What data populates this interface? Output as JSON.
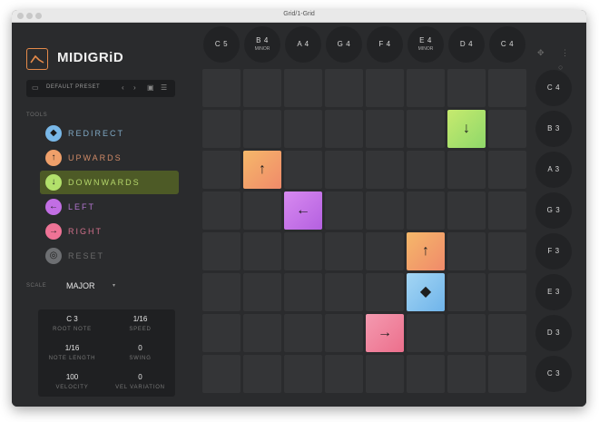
{
  "window_title": "Grid/1-Grid",
  "app_name": "MIDIGRiD",
  "preset": {
    "name": "DEFAULT PRESET",
    "prev": "‹",
    "next": "›"
  },
  "tools_heading": "TOOLS",
  "tools": [
    {
      "label": "REDIRECT",
      "icon": "◆",
      "color": "#79b8e8",
      "text_color": "#7fa8c4",
      "active": false
    },
    {
      "label": "UPWARDS",
      "icon": "↑",
      "color": "#f0a06a",
      "text_color": "#cf8a67",
      "active": false
    },
    {
      "label": "DOWNWARDS",
      "icon": "↓",
      "color": "#b2e06b",
      "text_color": "#b4d66b",
      "active": true
    },
    {
      "label": "LEFT",
      "icon": "←",
      "color": "#c26ee4",
      "text_color": "#b276cf",
      "active": false
    },
    {
      "label": "RIGHT",
      "icon": "→",
      "color": "#ee7396",
      "text_color": "#d0708a",
      "active": false
    },
    {
      "label": "RESET",
      "icon": "◎",
      "color": "#6d6f72",
      "text_color": "#6a6a6a",
      "active": false
    }
  ],
  "scale": {
    "label": "SCALE",
    "value": "MAJOR",
    "caret": "▾"
  },
  "params": [
    {
      "value": "C 3",
      "label": "ROOT NOTE"
    },
    {
      "value": "1/16",
      "label": "SPEED"
    },
    {
      "value": "1/16",
      "label": "NOTE LENGTH"
    },
    {
      "value": "0",
      "label": "SWING"
    },
    {
      "value": "100",
      "label": "VELOCITY"
    },
    {
      "value": "0",
      "label": "VEL VARIATION"
    }
  ],
  "top_notes": [
    {
      "note": "C 5",
      "mode": ""
    },
    {
      "note": "B 4",
      "mode": "MINOR"
    },
    {
      "note": "A 4",
      "mode": ""
    },
    {
      "note": "G 4",
      "mode": ""
    },
    {
      "note": "F 4",
      "mode": ""
    },
    {
      "note": "E 4",
      "mode": "MINOR"
    },
    {
      "note": "D 4",
      "mode": ""
    },
    {
      "note": "C 4",
      "mode": ""
    }
  ],
  "side_notes": [
    "C 4",
    "B 3",
    "A 3",
    "G 3",
    "F 3",
    "E 3",
    "D 3",
    "C 3"
  ],
  "arrows": [
    {
      "row": 1,
      "col": 6,
      "icon": "↓",
      "gradient": "linear-gradient(135deg,#c6ea6e,#8fd86a)",
      "name": "downwards"
    },
    {
      "row": 2,
      "col": 1,
      "icon": "↑",
      "gradient": "linear-gradient(135deg,#f5b86a,#f08a6a)",
      "name": "upwards"
    },
    {
      "row": 3,
      "col": 2,
      "icon": "←",
      "gradient": "linear-gradient(135deg,#d88af0,#b460e0)",
      "name": "left"
    },
    {
      "row": 4,
      "col": 5,
      "icon": "↑",
      "gradient": "linear-gradient(135deg,#f5b86a,#f08a6a)",
      "name": "upwards"
    },
    {
      "row": 5,
      "col": 5,
      "icon": "◆",
      "gradient": "linear-gradient(135deg,#a4d6f4,#6fb4ea)",
      "name": "redirect"
    },
    {
      "row": 6,
      "col": 4,
      "icon": "→",
      "gradient": "linear-gradient(135deg,#f49ab0,#ec6f8c)",
      "name": "right"
    }
  ],
  "utility_icons": {
    "move": "✥",
    "more": "⋮",
    "circle": "○"
  }
}
